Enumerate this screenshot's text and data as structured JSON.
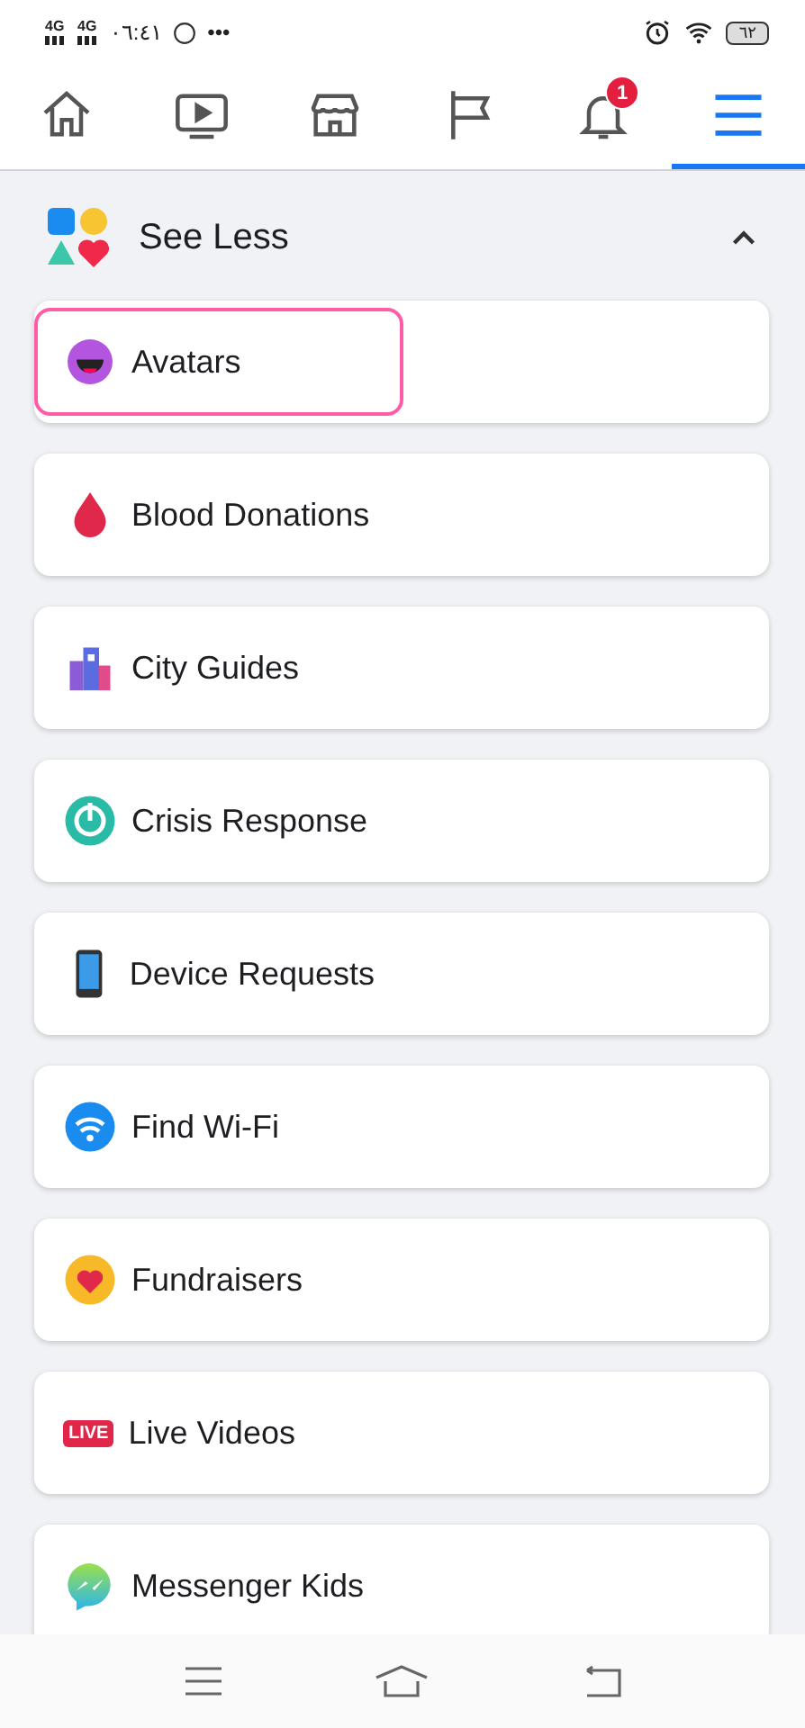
{
  "status_bar": {
    "signals": [
      "4G",
      "4G"
    ],
    "time": "٠٦:٤١",
    "more": "•••",
    "battery": "٦٢"
  },
  "nav_tabs": [
    {
      "kind": "home",
      "selected": false
    },
    {
      "kind": "video",
      "selected": false
    },
    {
      "kind": "store",
      "selected": false
    },
    {
      "kind": "flag",
      "selected": false
    },
    {
      "kind": "bell",
      "selected": false,
      "badge": "1"
    },
    {
      "kind": "menu",
      "selected": true
    }
  ],
  "section": {
    "title": "See Less",
    "expanded": true
  },
  "items": [
    {
      "label": "Avatars",
      "kind": "avatar",
      "highlighted": true
    },
    {
      "label": "Blood Donations",
      "kind": "drop",
      "highlighted": false
    },
    {
      "label": "City Guides",
      "kind": "city",
      "highlighted": false
    },
    {
      "label": "Crisis Response",
      "kind": "crisis",
      "highlighted": false
    },
    {
      "label": "Device Requests",
      "kind": "phone",
      "highlighted": false
    },
    {
      "label": "Find Wi-Fi",
      "kind": "wifi",
      "highlighted": false
    },
    {
      "label": "Fundraisers",
      "kind": "heart",
      "highlighted": false
    },
    {
      "label": "Live Videos",
      "kind": "live",
      "icon_text": "LIVE",
      "highlighted": false
    },
    {
      "label": "Messenger Kids",
      "kind": "messenger",
      "highlighted": false
    }
  ]
}
